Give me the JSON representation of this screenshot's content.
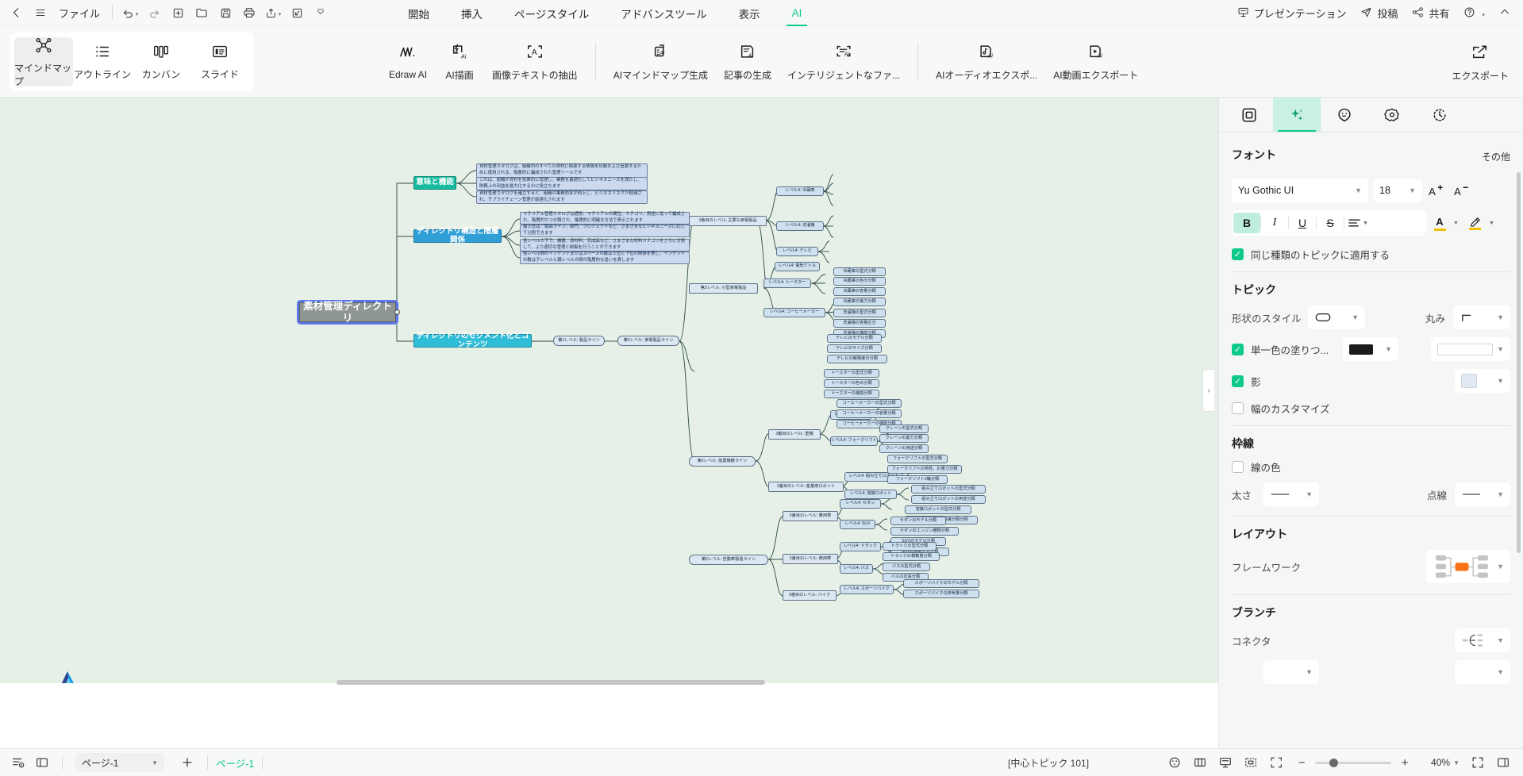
{
  "menubar": {
    "back_icon": "chevron-left-icon",
    "menu_icon": "hamburger-icon",
    "file_label": "ファイル",
    "quick_icons": [
      "undo-icon",
      "redo-icon",
      "new-icon",
      "open-icon",
      "save-icon",
      "print-icon",
      "share-export-icon",
      "import-icon",
      "more-icon"
    ],
    "tabs": [
      {
        "label": "開始",
        "active": false
      },
      {
        "label": "挿入",
        "active": false
      },
      {
        "label": "ページスタイル",
        "active": false
      },
      {
        "label": "アドバンスツール",
        "active": false
      },
      {
        "label": "表示",
        "active": false
      },
      {
        "label": "AI",
        "active": true
      }
    ],
    "right_items": [
      {
        "label": "プレゼンテーション",
        "icon": "presentation-icon"
      },
      {
        "label": "投稿",
        "icon": "send-icon"
      },
      {
        "label": "共有",
        "icon": "share-icon"
      },
      {
        "label": "",
        "icon": "help-icon"
      },
      {
        "label": "",
        "icon": "chevron-up-icon"
      }
    ]
  },
  "ribbon": {
    "views": [
      {
        "label": "マインドマップ",
        "icon": "mindmap-icon",
        "active": true
      },
      {
        "label": "アウトライン",
        "icon": "outline-icon",
        "active": false
      },
      {
        "label": "カンバン",
        "icon": "kanban-icon",
        "active": false
      },
      {
        "label": "スライド",
        "icon": "slide-icon",
        "active": false
      }
    ],
    "ai_tools_group1": [
      {
        "label": "Edraw AI",
        "icon": "edraw-ai-icon"
      },
      {
        "label": "AI描画",
        "icon": "ai-draw-icon"
      },
      {
        "label": "画像テキストの抽出",
        "icon": "ocr-icon"
      }
    ],
    "ai_tools_group2": [
      {
        "label": "AIマインドマップ生成",
        "icon": "ai-mindmap-icon"
      },
      {
        "label": "記事の生成",
        "icon": "ai-article-icon"
      },
      {
        "label": "インテリジェントなファ...",
        "icon": "ai-file-icon"
      }
    ],
    "ai_tools_group3": [
      {
        "label": "AIオーディオエクスポ...",
        "icon": "ai-audio-icon"
      },
      {
        "label": "AI動画エクスポート",
        "icon": "ai-video-icon"
      }
    ],
    "export": {
      "label": "エクスポート",
      "icon": "export-icon"
    }
  },
  "canvas": {
    "background": "#e7f0e6",
    "root": {
      "label": "素材管理ディレクトリ"
    },
    "branch1": {
      "label": "意味と機能"
    },
    "branch1_children": [
      "資材管理カタログは、組織内のすべての資材に関連する情報を記録および追跡するために使用される、階層的に編成された管理ツールです",
      "これは、組織が資材を効果的に管理し、業務を最適化してビジネスニーズを満たし、財務上の利益を最大化するのに役立ちます",
      "資材管理カタログを確立すると、組織の業務効率が向上し、ビジネスリスクが軽減され、サプライチェーン管理が最適化されます"
    ],
    "branch2": {
      "label": "ディレクトリ構造と階層関係"
    },
    "branch2_children": [
      "マテリアル管理カタログは通常、マテリアルの属性、カテゴリ、用途に従って編成され、階層的かつ分類され、論理的に明確な方法で表示されます",
      "最上位は、製品ライン、部門、プロジェクトなど、さまざまなビジネスニーズに応じて分割できます",
      "各レベルの下で、機器、原材料、完成品など、さまざまな材料カテゴリをさらに分割して、より適切な管理と制御を行うことができます",
      "各レベル間のインデントまたはスペースの数は上位と下位の関係を表し、インデントの数は子レベルと親レベルの間の階層的な違いを表します"
    ],
    "branch3": {
      "label": "ディレクトリのセグメント化とコンテンツ"
    },
    "level1": [
      {
        "label": "第1レベル: 製品ライン"
      }
    ],
    "level2": [
      {
        "label": "第2レベル: 家電製品ライン"
      },
      {
        "label": "第2レベル: 産業機器ライン"
      },
      {
        "label": "第2レベル: 自動車製造ライン"
      }
    ],
    "level3": [
      {
        "label": "3番目のレベル: 主要な家電製品"
      },
      {
        "label": "第3レベル: 小型家電製品"
      },
      {
        "label": "3番目のレベル: 重機"
      },
      {
        "label": "3番目のレベル: 産業用ロボット"
      },
      {
        "label": "3番目のレベル: 乗用車"
      },
      {
        "label": "3番目のレベル: 商用車"
      },
      {
        "label": "3番目のレベル: バイク"
      }
    ],
    "level4": [
      {
        "label": "レベル4: 冷蔵庫"
      },
      {
        "label": "レベル4: 洗濯機"
      },
      {
        "label": "レベル4: テレビ"
      },
      {
        "label": "レベル4: 電気ケトル"
      },
      {
        "label": "レベル4: トースター"
      },
      {
        "label": "レベル4: コーヒーメーカー"
      },
      {
        "label": "レベル4: クレーン"
      },
      {
        "label": "レベル4: フォークリフト"
      },
      {
        "label": "レベル4: 組み立てロボット"
      },
      {
        "label": "レベル4: 溶接ロボット"
      },
      {
        "label": "レベル4: セダン"
      },
      {
        "label": "レベル4: SUV"
      },
      {
        "label": "レベル4: トラック"
      },
      {
        "label": "レベル4: バス"
      },
      {
        "label": "レベル4: スポーツバイク"
      }
    ],
    "level5": [
      {
        "label": "冷蔵庫の型式分類"
      },
      {
        "label": "冷蔵庫の色の分類"
      },
      {
        "label": "冷蔵庫の容量分類"
      },
      {
        "label": "冷蔵庫の電力分類"
      },
      {
        "label": "洗濯機の型式分類"
      },
      {
        "label": "洗濯機の容量区分"
      },
      {
        "label": "洗濯機の機能分類"
      },
      {
        "label": "テレビのモデル分類"
      },
      {
        "label": "テレビのサイズ分類"
      },
      {
        "label": "テレビの解像度の分類"
      },
      {
        "label": "トースターの型式分類"
      },
      {
        "label": "トースターの色の分類"
      },
      {
        "label": "トースターの機能分類"
      },
      {
        "label": "コーヒーメーカーの型式分類"
      },
      {
        "label": "コーヒーメーカーの容量分類"
      },
      {
        "label": "コーヒーメーカーの機能分類"
      },
      {
        "label": "クレーンの型式分類"
      },
      {
        "label": "クレーンの能力分類"
      },
      {
        "label": "クレーンの用途分類"
      },
      {
        "label": "フォークリフトの型式分類"
      },
      {
        "label": "フォークリフトの特性、計量力分類"
      },
      {
        "label": "フォークリフト2輪分類"
      },
      {
        "label": "組み立てロボットの型式分類"
      },
      {
        "label": "組み立てロボットの用途分類"
      },
      {
        "label": "溶接ロボットの型式分類"
      },
      {
        "label": "溶接ロボットの溶接分類分類"
      },
      {
        "label": "セダンのモデル分類"
      },
      {
        "label": "セダンのエンジン種類分類"
      },
      {
        "label": "SUVのモデル分類"
      },
      {
        "label": "SUVの駆動方式分類"
      },
      {
        "label": "トラックの型式分類"
      },
      {
        "label": "トラックの積載量分類"
      },
      {
        "label": "バスの型式分類"
      },
      {
        "label": "バスの定員分類"
      },
      {
        "label": "スポーツバイクのモデル分類"
      },
      {
        "label": "スポーツバイクの排気量分類"
      }
    ]
  },
  "right_panel": {
    "tabs": [
      {
        "icon": "shape-icon",
        "active": false
      },
      {
        "icon": "ai-sparkle-icon",
        "active": true
      },
      {
        "icon": "emoji-icon",
        "active": false
      },
      {
        "icon": "settings-flower-icon",
        "active": false
      },
      {
        "icon": "history-icon",
        "active": false
      }
    ],
    "font_section": {
      "title": "フォント",
      "other_label": "その他",
      "font_family": "Yu Gothic UI",
      "font_size": "18",
      "increase_icon": "increase-font-icon",
      "decrease_icon": "decrease-font-icon",
      "bold": "B",
      "italic": "I",
      "underline": "U",
      "strikethrough": "S",
      "align_icon": "align-icon",
      "font_color_icon": "A",
      "highlight_icon": "highlight-icon",
      "apply_same_type": "同じ種類のトピックに適用する",
      "apply_same_type_checked": true
    },
    "topic_section": {
      "title": "トピック",
      "shape_style_label": "形状のスタイル",
      "roundness_label": "丸み",
      "solid_fill_label": "単一色の塗りつ...",
      "solid_fill_checked": true,
      "shadow_label": "影",
      "shadow_checked": true,
      "custom_width_label": "幅のカスタマイズ",
      "custom_width_checked": false
    },
    "border_section": {
      "title": "枠線",
      "line_color_label": "線の色",
      "line_color_checked": false,
      "thickness_label": "太さ",
      "dashes_label": "点線"
    },
    "layout_section": {
      "title": "レイアウト",
      "framework_label": "フレームワーク"
    },
    "branch_section": {
      "title": "ブランチ",
      "connector_label": "コネクタ"
    }
  },
  "statusbar": {
    "outline_icon": "outline-view-icon",
    "pane_icon": "pane-view-icon",
    "page_select": "ページ-1",
    "add_page_icon": "plus-icon",
    "page_tab": "ページ-1",
    "center_topic": "[中心トピック 101]",
    "right_icons": [
      "color-icon",
      "split-icon",
      "present-icon",
      "fit-icon",
      "fullscreen-icon"
    ],
    "zoom_minus": "−",
    "zoom_plus": "+",
    "zoom_value": "40%",
    "expand_icon": "expand-icon",
    "sidebar-toggle-icon": "sidebar-icon"
  },
  "colors": {
    "accent": "#0ec98b",
    "canvas_bg": "#e7f0e6",
    "root_fill": "#8e9794",
    "branch1_fill": "#17bba0",
    "branch2_fill": "#2f9fd6",
    "branch3_fill": "#2fbcd6",
    "leaf_fill": "#ccd9ee",
    "selection": "#5b76e8",
    "highlight_yellow": "#f5bf00",
    "framework_orange": "#f97316"
  }
}
